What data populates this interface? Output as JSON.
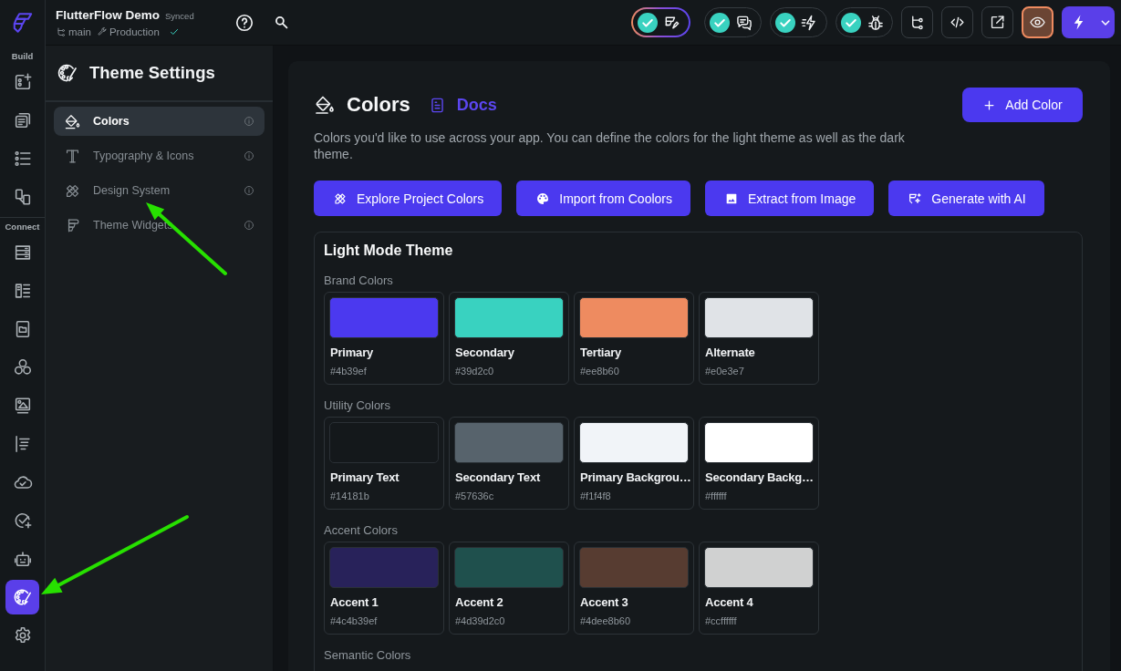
{
  "top_bar": {
    "project_name": "FlutterFlow Demo",
    "sync_status": "Synced",
    "branch": "main",
    "environment": "Production",
    "checks": [
      {
        "ok": true,
        "highlighted": true
      },
      {
        "ok": true,
        "highlighted": false
      },
      {
        "ok": true,
        "highlighted": false
      },
      {
        "ok": true,
        "highlighted": false
      }
    ],
    "preview_button": {
      "on": true
    }
  },
  "rail": {
    "groups": [
      {
        "label": "Build",
        "items": [
          {
            "selected": false
          },
          {
            "selected": false
          },
          {
            "selected": false
          },
          {
            "selected": false
          }
        ]
      },
      {
        "label": "Connect",
        "items": [
          {
            "selected": false
          },
          {
            "selected": false
          },
          {
            "selected": false
          },
          {
            "selected": false
          },
          {
            "selected": false
          },
          {
            "selected": false
          },
          {
            "selected": false
          },
          {
            "selected": false
          },
          {
            "selected": false
          },
          {
            "selected": true
          },
          {
            "selected": false
          }
        ]
      }
    ]
  },
  "sidebar": {
    "title": "Theme Settings",
    "items": [
      {
        "label": "Colors",
        "selected": true
      },
      {
        "label": "Typography & Icons",
        "selected": false
      },
      {
        "label": "Design System",
        "selected": false
      },
      {
        "label": "Theme Widgets",
        "selected": false
      }
    ]
  },
  "page": {
    "title": "Colors",
    "docs_link": "Docs",
    "add_button": "Add Color",
    "description": "Colors you'd like to use across your app. You can define the colors for the light theme as well as the dark theme.",
    "actions": [
      "Explore Project Colors",
      "Import from Coolors",
      "Extract from Image",
      "Generate with AI"
    ]
  },
  "theme_panel": {
    "title": "Light Mode Theme",
    "groups": [
      {
        "label": "Brand Colors",
        "colors": [
          {
            "name": "Primary",
            "hex": "#4b39ef",
            "color": "#4b39ef"
          },
          {
            "name": "Secondary",
            "hex": "#39d2c0",
            "color": "#39d2c0"
          },
          {
            "name": "Tertiary",
            "hex": "#ee8b60",
            "color": "#ee8b60"
          },
          {
            "name": "Alternate",
            "hex": "#e0e3e7",
            "color": "#e0e3e7"
          }
        ]
      },
      {
        "label": "Utility Colors",
        "colors": [
          {
            "name": "Primary Text",
            "hex": "#14181b",
            "color": "#14181b"
          },
          {
            "name": "Secondary Text",
            "hex": "#57636c",
            "color": "#57636c"
          },
          {
            "name": "Primary Backgrou…",
            "hex": "#f1f4f8",
            "color": "#f1f4f8"
          },
          {
            "name": "Secondary Backg…",
            "hex": "#ffffff",
            "color": "#ffffff"
          }
        ]
      },
      {
        "label": "Accent Colors",
        "colors": [
          {
            "name": "Accent 1",
            "hex": "#4c4b39ef",
            "color": "#28225a"
          },
          {
            "name": "Accent 2",
            "hex": "#4d39d2c0",
            "color": "#1f504d"
          },
          {
            "name": "Accent 3",
            "hex": "#4dee8b60",
            "color": "#573c31"
          },
          {
            "name": "Accent 4",
            "hex": "#ccffffff",
            "color": "#d0d1d1"
          }
        ]
      },
      {
        "label": "Semantic Colors"
      }
    ]
  },
  "annotations": [
    {
      "kind": "arrow"
    },
    {
      "kind": "arrow"
    }
  ]
}
